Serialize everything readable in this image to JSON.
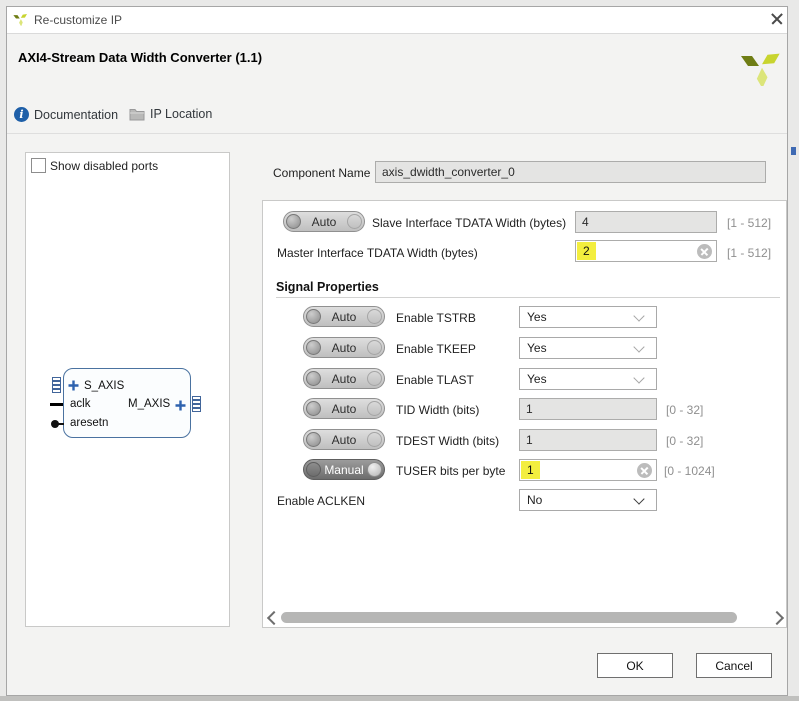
{
  "window": {
    "title": "Re-customize IP"
  },
  "header": {
    "title": "AXI4-Stream Data Width Converter (1.1)"
  },
  "tabs": {
    "documentation": "Documentation",
    "ip_location": "IP Location"
  },
  "icons": {
    "info_glyph": "i"
  },
  "left_panel": {
    "show_disabled_ports_label": "Show disabled ports",
    "checkbox_checked": false,
    "block_diagram": {
      "ports_left": [
        "S_AXIS",
        "aclk",
        "aresetn"
      ],
      "ports_right": [
        "M_AXIS"
      ]
    }
  },
  "component_name": {
    "label": "Component Name",
    "value": "axis_dwidth_converter_0"
  },
  "params": {
    "slave_tdata": {
      "toggle": "Auto",
      "label": "Slave Interface TDATA Width (bytes)",
      "value": "4",
      "range": "[1 - 512]"
    },
    "master_tdata": {
      "label": "Master Interface TDATA Width (bytes)",
      "value": "2",
      "range": "[1 - 512]",
      "highlighted": true
    },
    "section_title": "Signal Properties",
    "enable_tstrb": {
      "toggle": "Auto",
      "label": "Enable TSTRB",
      "value": "Yes"
    },
    "enable_tkeep": {
      "toggle": "Auto",
      "label": "Enable TKEEP",
      "value": "Yes"
    },
    "enable_tlast": {
      "toggle": "Auto",
      "label": "Enable TLAST",
      "value": "Yes"
    },
    "tid_width": {
      "toggle": "Auto",
      "label": "TID Width (bits)",
      "value": "1",
      "range": "[0 - 32]"
    },
    "tdest_width": {
      "toggle": "Auto",
      "label": "TDEST Width (bits)",
      "value": "1",
      "range": "[0 - 32]"
    },
    "tuser_bits": {
      "toggle": "Manual",
      "label": "TUSER bits per byte",
      "value": "1",
      "range": "[0 - 1024]",
      "highlighted": true
    },
    "enable_aclken": {
      "label": "Enable ACLKEN",
      "value": "No"
    }
  },
  "colors": {
    "highlight_yellow": "#f3ee3e",
    "block_border_blue": "#4a72a0",
    "info_icon_blue": "#1e5fa8",
    "logo_bright": "#c8d42f",
    "logo_dark": "#6f7d15",
    "logo_pale": "#dce57a"
  },
  "footer": {
    "ok": "OK",
    "cancel": "Cancel"
  }
}
